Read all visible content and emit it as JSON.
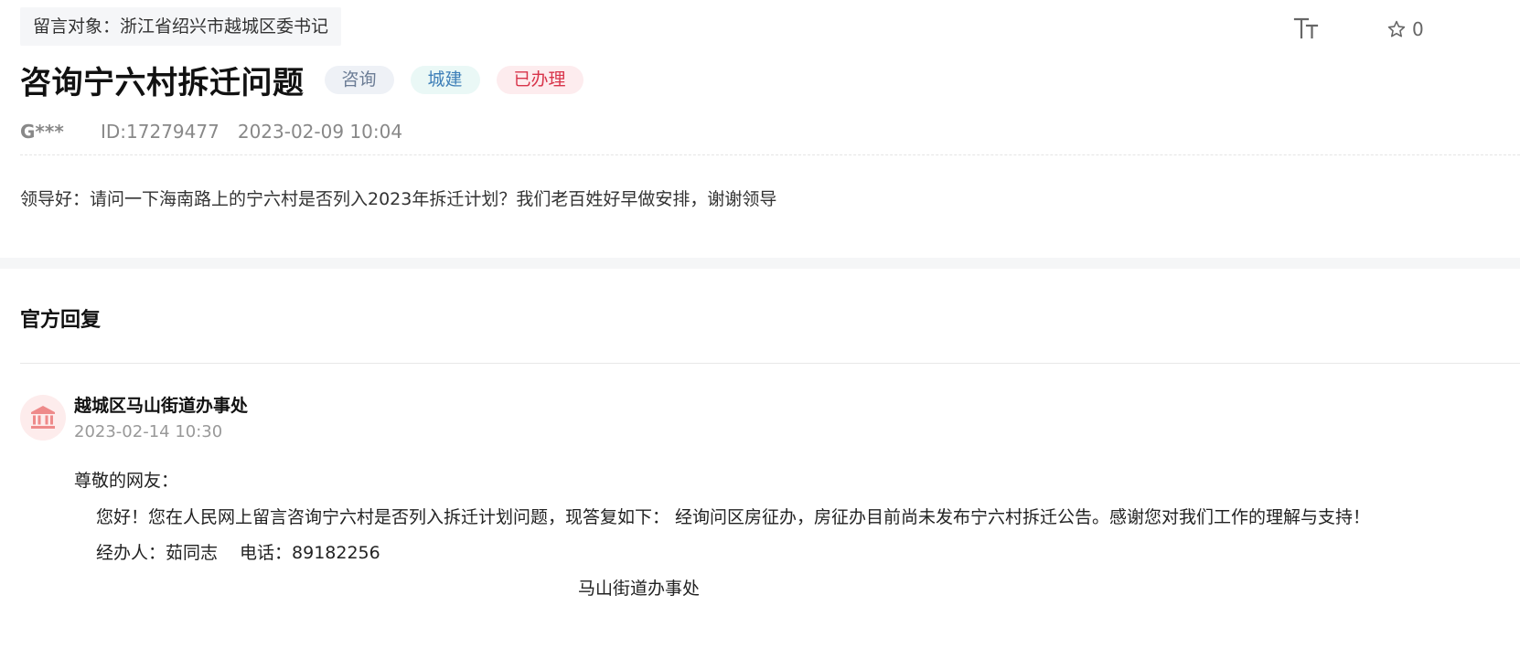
{
  "recipient": "留言对象：浙江省绍兴市越城区委书记",
  "toolbar": {
    "font_size_icon": "font-size-icon",
    "favorite_icon": "star-outline-icon",
    "favorite_count": "0"
  },
  "message": {
    "title": "咨询宁六村拆迁问题",
    "tags": {
      "type": "咨询",
      "field": "城建",
      "status": "已办理"
    },
    "author": "G***",
    "id": "ID:17279477",
    "datetime": "2023-02-09 10:04",
    "body": "领导好：请问一下海南路上的宁六村是否列入2023年拆迁计划？我们老百姓好早做安排，谢谢领导"
  },
  "reply": {
    "heading": "官方回复",
    "org_icon": "government-building-icon",
    "org_name": "越城区马山街道办事处",
    "datetime": "2023-02-14 10:30",
    "greeting": "尊敬的网友：",
    "main_text": "您好！您在人民网上留言咨询宁六村是否列入拆迁计划问题，现答复如下： 经询问区房征办，房征办目前尚未发布宁六村拆迁公告。感谢您对我们工作的理解与支持！",
    "handler": "经办人：茹同志",
    "phone": "电话：89182256",
    "signature": "马山街道办事处"
  },
  "colors": {
    "tag_type_bg": "#eef1f6",
    "tag_type_text": "#6b7c95",
    "tag_field_bg": "#eaf8f6",
    "tag_field_text": "#3e7fb8",
    "tag_status_bg": "#fdecee",
    "tag_status_text": "#d8344a",
    "org_icon": "#ee8a8a"
  }
}
